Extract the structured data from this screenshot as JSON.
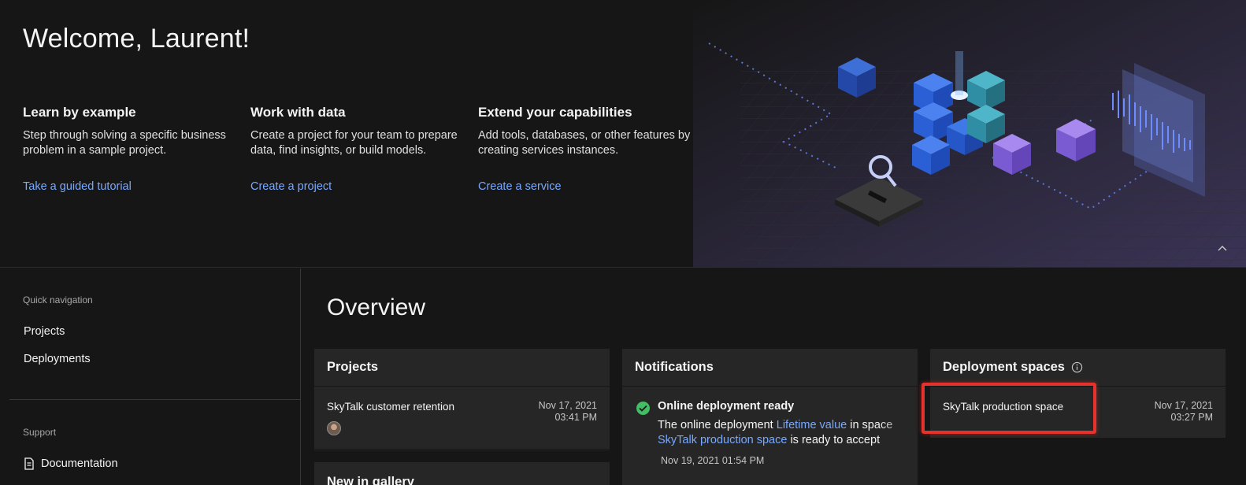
{
  "hero": {
    "title": "Welcome, Laurent!",
    "columns": [
      {
        "heading": "Learn by example",
        "text": "Step through solving a specific business problem in a sample project.",
        "link": "Take a guided tutorial"
      },
      {
        "heading": "Work with data",
        "text": "Create a project for your team to prepare data, find insights, or build models.",
        "link": "Create a project"
      },
      {
        "heading": "Extend your capabilities",
        "text": "Add tools, databases, or other features by creating services instances.",
        "link": "Create a service"
      }
    ],
    "collapse_icon": "chevron-up-icon"
  },
  "sidebar": {
    "quick_nav_heading": "Quick navigation",
    "quick_nav_items": [
      "Projects",
      "Deployments"
    ],
    "support_heading": "Support",
    "support_items": [
      {
        "label": "Documentation",
        "icon": "document-icon"
      }
    ]
  },
  "main": {
    "title": "Overview",
    "projects": {
      "header": "Projects",
      "rows": [
        {
          "name": "SkyTalk customer retention",
          "date": "Nov 17, 2021",
          "time": "03:41 PM"
        }
      ]
    },
    "notifications": {
      "header": "Notifications",
      "items": [
        {
          "title": "Online deployment ready",
          "body_prefix": "The online deployment ",
          "body_link1": "Lifetime value",
          "body_mid": " in space",
          "body_link2": "SkyTalk production space",
          "body_suffix": " is ready to accept",
          "timestamp": "Nov 19, 2021 01:54 PM",
          "status_color": "#42be65"
        }
      ]
    },
    "deployment_spaces": {
      "header": "Deployment spaces",
      "info_icon": "info-icon",
      "rows": [
        {
          "name": "SkyTalk production space",
          "date": "Nov 17, 2021",
          "time": "03:27 PM"
        }
      ]
    },
    "gallery_peek": "New in gallery"
  },
  "colors": {
    "background": "#161616",
    "card": "#262626",
    "link": "#78a9ff",
    "highlight": "#e5322d",
    "success": "#42be65"
  }
}
